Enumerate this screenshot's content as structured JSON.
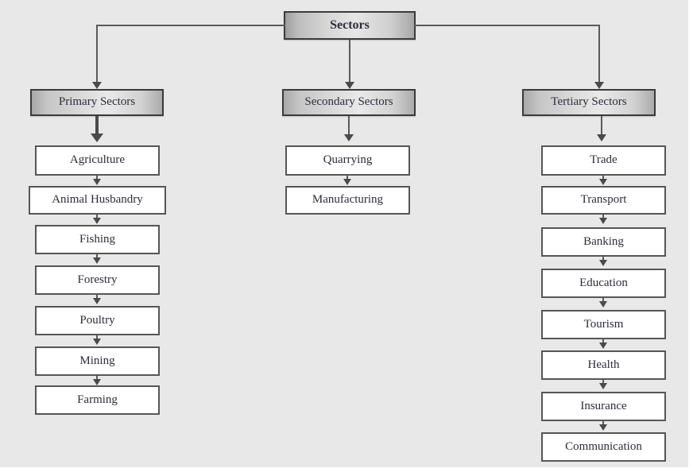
{
  "diagram": {
    "type": "hierarchy-flowchart",
    "background_color": "#e8e8e8",
    "root": {
      "label": "Sectors",
      "style": "gradient-gray"
    },
    "branches": [
      {
        "id": "primary",
        "header": "Primary Sectors",
        "items": [
          "Agriculture",
          "Animal Husbandry",
          "Fishing",
          "Forestry",
          "Poultry",
          "Mining",
          "Farming"
        ]
      },
      {
        "id": "secondary",
        "header": "Secondary Sectors",
        "items": [
          "Quarrying",
          "Manufacturing"
        ]
      },
      {
        "id": "tertiary",
        "header": "Tertiary Sectors",
        "items": [
          "Trade",
          "Transport",
          "Banking",
          "Education",
          "Tourism",
          "Health",
          "Insurance",
          "Communication"
        ]
      }
    ],
    "colors": {
      "background": "#e8e8e8",
      "box_border_header": "#3b3b3b",
      "box_border_leaf": "#565656",
      "leaf_fill": "#ffffff",
      "connector": "#5a5a5a",
      "text": "#2d2d3a"
    }
  }
}
